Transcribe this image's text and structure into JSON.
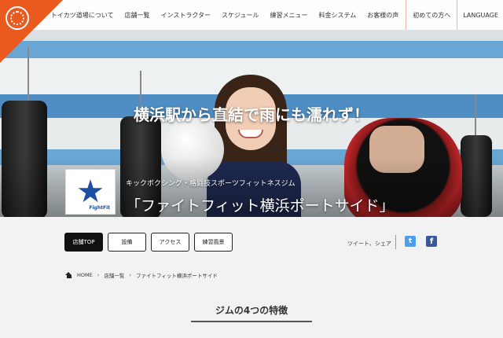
{
  "nav": {
    "items": [
      "トイカツ道場について",
      "店舗一覧",
      "インストラクター",
      "スケジュール",
      "練習メニュー",
      "料金システム",
      "お客様の声"
    ],
    "first_time": "初めての方へ",
    "language": "LANGUAGE"
  },
  "hero": {
    "headline": "横浜駅から直結で雨にも濡れず！",
    "subtitle": "キックボクシング・格闘技スポーツフィットネスジム",
    "gym_name": "「ファイトフィット横浜ポートサイド」",
    "logo_text": "FightFit"
  },
  "tabs": [
    "店舗TOP",
    "設備",
    "アクセス",
    "練習風景"
  ],
  "share": {
    "label": "ツイート、シェア",
    "twitter_glyph": "t",
    "facebook_glyph": "f"
  },
  "breadcrumb": {
    "home": "HOME",
    "sep": "›",
    "items": [
      "店舗一覧",
      "ファイトフィット横浜ポートサイド"
    ]
  },
  "section": {
    "title": "ジムの4つの特徴"
  },
  "colors": {
    "accent": "#ea5a1f",
    "twitter": "#4aa1eb",
    "facebook": "#3b5998",
    "brand_blue": "#1c4ea1"
  }
}
